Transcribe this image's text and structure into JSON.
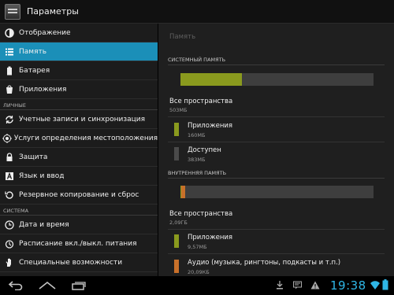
{
  "app": {
    "title": "Параметры"
  },
  "sidebar": {
    "items_top": [
      {
        "label": "Отображение",
        "icon": "brightness-icon"
      },
      {
        "label": "Память",
        "icon": "storage-list-icon",
        "selected": true
      },
      {
        "label": "Батарея",
        "icon": "battery-icon"
      },
      {
        "label": "Приложения",
        "icon": "apps-icon"
      }
    ],
    "section_personal": "ЛИЧНЫЕ",
    "items_personal": [
      {
        "label": "Учетные записи и синхронизация",
        "icon": "sync-icon"
      },
      {
        "label": "Услуги определения местоположения",
        "icon": "location-icon"
      },
      {
        "label": "Защита",
        "icon": "lock-icon"
      },
      {
        "label": "Язык и ввод",
        "icon": "keyboard-letter-icon"
      },
      {
        "label": "Резервное копирование и сброс",
        "icon": "backup-icon"
      }
    ],
    "section_system": "СИСТЕМА",
    "items_system": [
      {
        "label": "Дата и время",
        "icon": "clock-icon"
      },
      {
        "label": "Расписание вкл./выкл. питания",
        "icon": "power-schedule-icon"
      },
      {
        "label": "Специальные возможности",
        "icon": "hand-icon"
      }
    ]
  },
  "main": {
    "page_label": "Память",
    "system": {
      "header": "СИСТЕМНЫЙ ПАМЯТЬ",
      "used_fraction": 0.32,
      "total_label": "Все пространства",
      "total_value": "503МБ",
      "apps_label": "Приложения",
      "apps_value": "160МБ",
      "available_label": "Доступен",
      "available_value": "383МБ"
    },
    "internal": {
      "header": "ВНУТРЕННЯЯ ПАМЯТЬ",
      "apps_fraction": 0.005,
      "audio_fraction": 0.02,
      "total_label": "Все пространства",
      "total_value": "2,09ГБ",
      "apps_label": "Приложения",
      "apps_value": "9,57МБ",
      "audio_label": "Аудио (музыка, рингтоны, подкасты и т.п.)",
      "audio_value": "20,09КБ"
    }
  },
  "colors": {
    "apps": "#8a9a1e",
    "available": "#4a4a4a",
    "audio": "#c8702a",
    "accent": "#1b8fb8",
    "clock": "#2fb6e6"
  },
  "statusbar": {
    "time": "19:38"
  }
}
